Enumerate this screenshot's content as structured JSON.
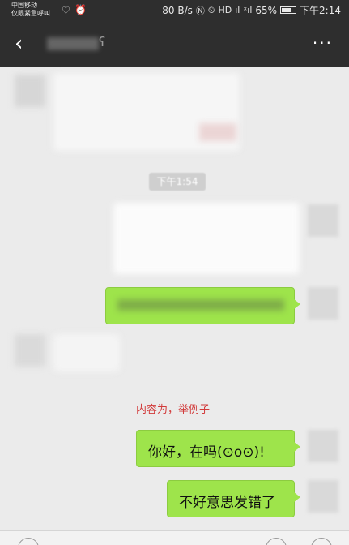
{
  "status_bar": {
    "carrier_line1": "中国移动",
    "carrier_line2": "仅限紧急呼叫",
    "network_speed": "80 B/s",
    "battery_percent": "65%",
    "time": "下午2:14",
    "icons": [
      "heart-icon",
      "alarm-icon",
      "nfc-icon",
      "hd-icon",
      "signal-icon",
      "battery-icon"
    ]
  },
  "title_bar": {
    "back_icon": "‹",
    "more_icon": "···",
    "ear_icon": "ʕ"
  },
  "chat": {
    "timestamp": "下午1:54",
    "annotation": "内容为，举例子",
    "messages": [
      {
        "text": "你好，在吗(⊙o⊙)!"
      },
      {
        "text": "不好意思发错了"
      }
    ]
  },
  "colors": {
    "header_bg": "#2e2e2e",
    "chat_bg": "#ebebeb",
    "sent_bubble": "#9ee44b",
    "annotation_red": "#d23b3b"
  }
}
